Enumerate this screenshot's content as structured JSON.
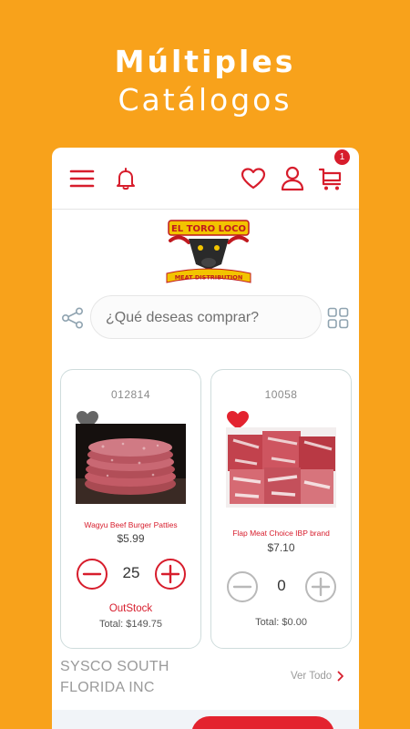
{
  "headline": {
    "line1": "Múltiples",
    "line2": "Catálogos"
  },
  "topbar": {
    "icons": [
      "menu-icon",
      "bell-icon",
      "heart-icon",
      "user-icon",
      "cart-icon"
    ],
    "cart_count": "1"
  },
  "search": {
    "placeholder": "¿Qué deseas comprar?"
  },
  "products": [
    {
      "sku": "012814",
      "favorite": false,
      "name": "Wagyu Beef Burger Patties",
      "price": "$5.99",
      "quantity": "25",
      "stock": "OutStock",
      "total": "Total: $149.75"
    },
    {
      "sku": "10058",
      "favorite": true,
      "name": "Flap Meat Choice IBP brand",
      "price": "$7.10",
      "quantity": "0",
      "total": "Total: $0.00"
    }
  ],
  "vendor": {
    "name": "SYSCO SOUTH FLORIDA INC",
    "see_all": "Ver Todo"
  },
  "colors": {
    "accent": "#d71d2c",
    "background": "#f8a21b"
  }
}
